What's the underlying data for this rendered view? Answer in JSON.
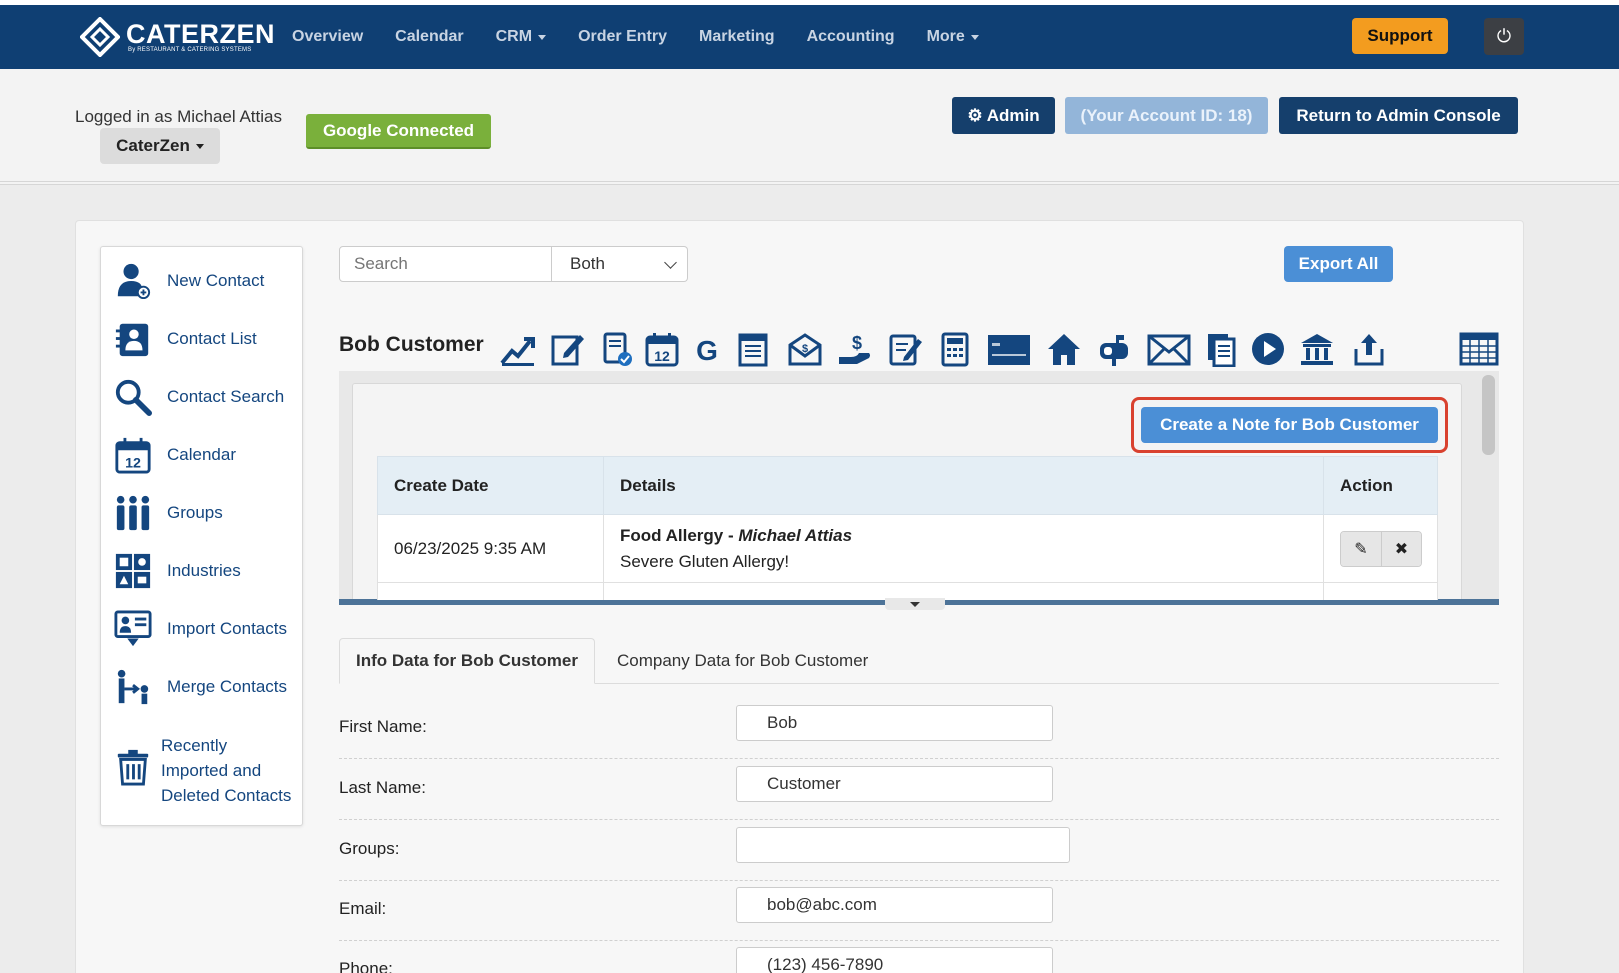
{
  "topnav": {
    "brand": "CATERZEN",
    "brand_sub": "By RESTAURANT & CATERING SYSTEMS",
    "items": [
      "Overview",
      "Calendar",
      "CRM",
      "Order Entry",
      "Marketing",
      "Accounting",
      "More"
    ],
    "support": "Support",
    "power_icon": "⏻"
  },
  "header": {
    "logged_in": "Logged in as Michael Attias",
    "account": "CaterZen",
    "google": "Google Connected",
    "admin": "⚙ Admin",
    "account_id": "(Your Account ID: 18)",
    "return": "Return to Admin Console"
  },
  "sidebar": {
    "items": [
      {
        "label": "New Contact",
        "icon": "new-contact-icon"
      },
      {
        "label": "Contact List",
        "icon": "contact-list-icon"
      },
      {
        "label": "Contact Search",
        "icon": "magnifier-icon"
      },
      {
        "label": "Calendar",
        "icon": "calendar-icon"
      },
      {
        "label": "Groups",
        "icon": "groups-icon"
      },
      {
        "label": "Industries",
        "icon": "industries-icon"
      },
      {
        "label": "Import Contacts",
        "icon": "import-icon"
      },
      {
        "label": "Merge Contacts",
        "icon": "merge-icon"
      },
      {
        "label": "Recently\nImported and\nDeleted Contacts",
        "icon": "trash-icon"
      }
    ]
  },
  "search": {
    "placeholder": "Search",
    "filter": "Both",
    "export": "Export All"
  },
  "contact": {
    "name": "Bob Customer"
  },
  "notes": {
    "create_button": "Create a Note for Bob Customer",
    "columns": [
      "Create Date",
      "Details",
      "Action"
    ],
    "rows": [
      {
        "date": "06/23/2025 9:35 AM",
        "title": "Food Allergy",
        "sep": " - ",
        "author": "Michael Attias",
        "body": "Severe Gluten Allergy!"
      }
    ]
  },
  "tabs": [
    "Info Data for Bob Customer",
    "Company Data for Bob Customer"
  ],
  "form": [
    {
      "label": "First Name:",
      "value": "Bob"
    },
    {
      "label": "Last Name:",
      "value": "Customer"
    },
    {
      "label": "Groups:",
      "value": ""
    },
    {
      "label": "Email:",
      "value": "bob@abc.com"
    },
    {
      "label": "Phone:",
      "value": "(123) 456-7890"
    }
  ],
  "colors": {
    "nav": "#0f3f73",
    "accent": "#4b8fd6",
    "support": "#f39c1f",
    "google": "#7ab03b",
    "highlight": "#d9412e",
    "link": "#14467f"
  }
}
